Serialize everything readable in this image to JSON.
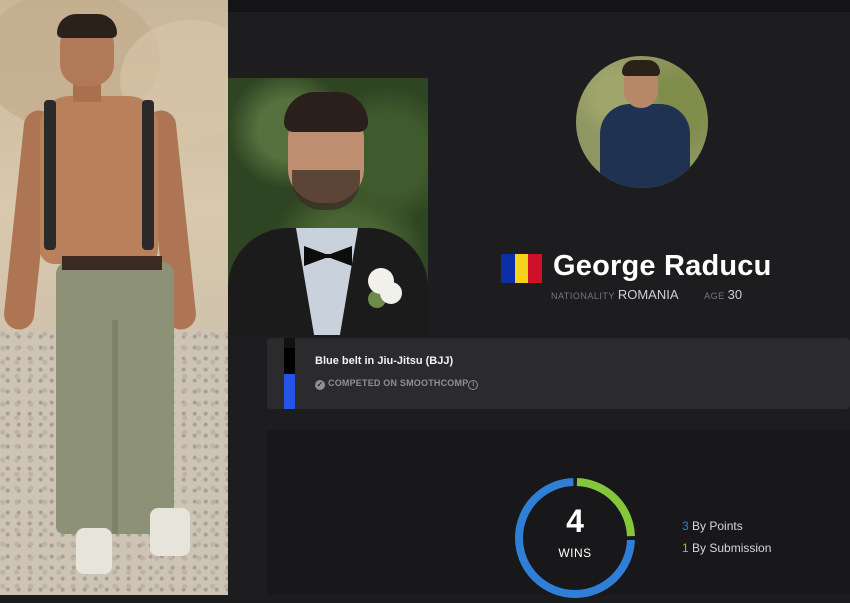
{
  "profile": {
    "name": "George Raducu",
    "nationality_label": "NATIONALITY",
    "nationality": "ROMANIA",
    "age_label": "AGE",
    "age": "30",
    "flag_colors": [
      "#0b2fa8",
      "#f7d21b",
      "#ce1126"
    ]
  },
  "belt": {
    "title": "Blue belt in Jiu-Jitsu (BJJ)",
    "subtitle": "COMPETED ON SMOOTHCOMP",
    "color": "#2455e5"
  },
  "stats": {
    "wins": "4",
    "wins_label": "WINS",
    "by_points_count": "3",
    "by_points_label": "By Points",
    "by_submission_count": "1",
    "by_submission_label": "By Submission",
    "points_color": "#2f7fd6",
    "submission_color": "#86c63b",
    "points_fraction": 0.75,
    "submission_fraction": 0.25
  },
  "icons": {
    "verified": "check-circle-icon",
    "info": "info-icon"
  }
}
